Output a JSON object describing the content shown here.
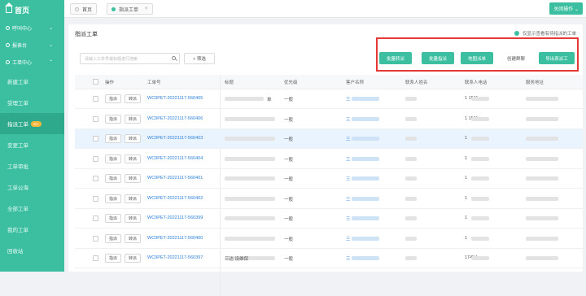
{
  "sidebar": {
    "logo": "首页",
    "groups": [
      {
        "label": "呼叫中心"
      },
      {
        "label": "报表台"
      },
      {
        "label": "工单中心"
      }
    ],
    "items": [
      {
        "label": "新建工单"
      },
      {
        "label": "受理工单"
      },
      {
        "label": "指派工单",
        "badge": "99+"
      },
      {
        "label": "变更工单"
      },
      {
        "label": "工单审批"
      },
      {
        "label": "工单公海"
      },
      {
        "label": "全部工单"
      },
      {
        "label": "我的工单"
      },
      {
        "label": "回收站"
      }
    ]
  },
  "topbar": {
    "tabs": [
      {
        "label": "首页"
      },
      {
        "label": "指派工单",
        "close": "×"
      }
    ],
    "close_ops": "关闭操作 ⌄"
  },
  "panel": {
    "title": "指派工单",
    "notice": "仅显示查看有待指派的工单",
    "search_placeholder": "请输入工单号或标题进行搜索",
    "filter_label": "+ 筛选",
    "actions": [
      "批量转派",
      "批量指派",
      "地图派单",
      "创建群聊",
      "导出表派工"
    ]
  },
  "table": {
    "columns": [
      "操作",
      "工单号",
      "标题",
      "优先级",
      "客户名称",
      "联系人姓名",
      "联系人电话",
      "服务地址"
    ],
    "assign_label": "指派",
    "transfer_label": "转派",
    "rows": [
      {
        "id": "WC9PET-20221117-560405",
        "priority": "一般",
        "customer": "三",
        "phone": "1        1511",
        "title_tail": "单"
      },
      {
        "id": "WC9PET-20221117-560406",
        "priority": "一般",
        "customer": "三",
        "phone": "1        1511",
        "title_tail": ""
      },
      {
        "id": "WC9PET-20221117-560403",
        "priority": "一般",
        "customer": "三",
        "phone": "1",
        "title_tail": ""
      },
      {
        "id": "WC9PET-20221117-560404",
        "priority": "一般",
        "customer": "三",
        "phone": "1",
        "title_tail": ""
      },
      {
        "id": "WC9PET-20221117-560401",
        "priority": "一般",
        "customer": "三",
        "phone": "1",
        "title_tail": ""
      },
      {
        "id": "WC9PET-20221117-560402",
        "priority": "一般",
        "customer": "三",
        "phone": "1",
        "title_tail": ""
      },
      {
        "id": "WC9PET-20221117-560399",
        "priority": "一般",
        "customer": "三",
        "phone": "1",
        "title_tail": ""
      },
      {
        "id": "WC9PET-20221117-560400",
        "priority": "一般",
        "customer": "三",
        "phone": "1",
        "title_tail": ""
      },
      {
        "id": "WC9PET-20221117-560397",
        "priority": "一般",
        "customer": "三",
        "phone": "17454",
        "title_tail": "三达      设维保"
      }
    ]
  },
  "colors": {
    "accent": "#3bbfa0",
    "highlight_border": "#e53935",
    "link": "#2b7fd9"
  }
}
